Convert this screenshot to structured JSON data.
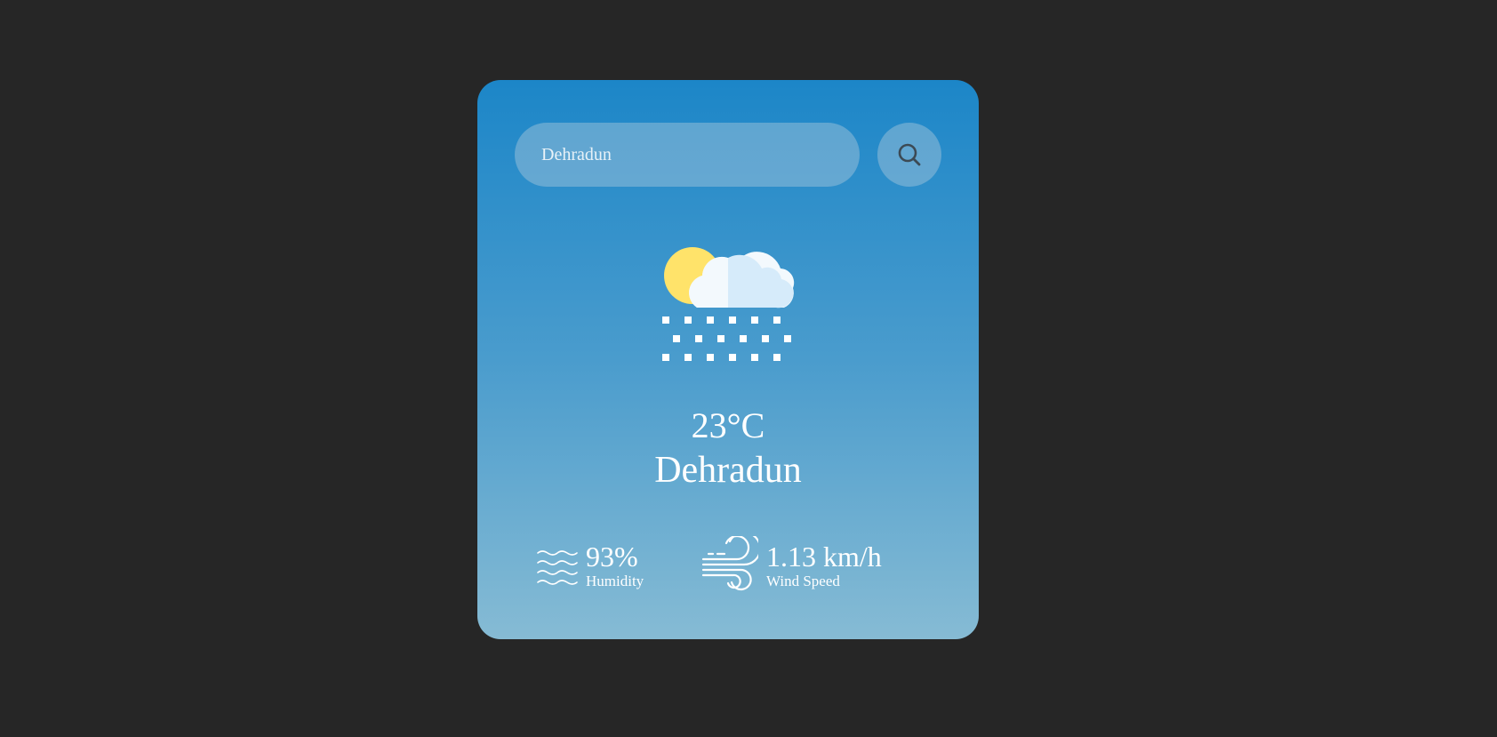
{
  "search": {
    "value": "Dehradun",
    "button_icon": "search-icon"
  },
  "weather": {
    "icon": "sun-cloud-snow-icon",
    "temperature": "23°C",
    "city": "Dehradun"
  },
  "details": {
    "humidity": {
      "value": "93%",
      "label": "Humidity",
      "icon": "humidity-waves-icon"
    },
    "wind": {
      "value": "1.13 km/h",
      "label": "Wind Speed",
      "icon": "wind-icon"
    }
  },
  "colors": {
    "background": "#262626",
    "card_top": "#1c86c8",
    "card_bottom": "#86bbd4",
    "sun": "#ffe36a",
    "text": "#ffffff"
  }
}
